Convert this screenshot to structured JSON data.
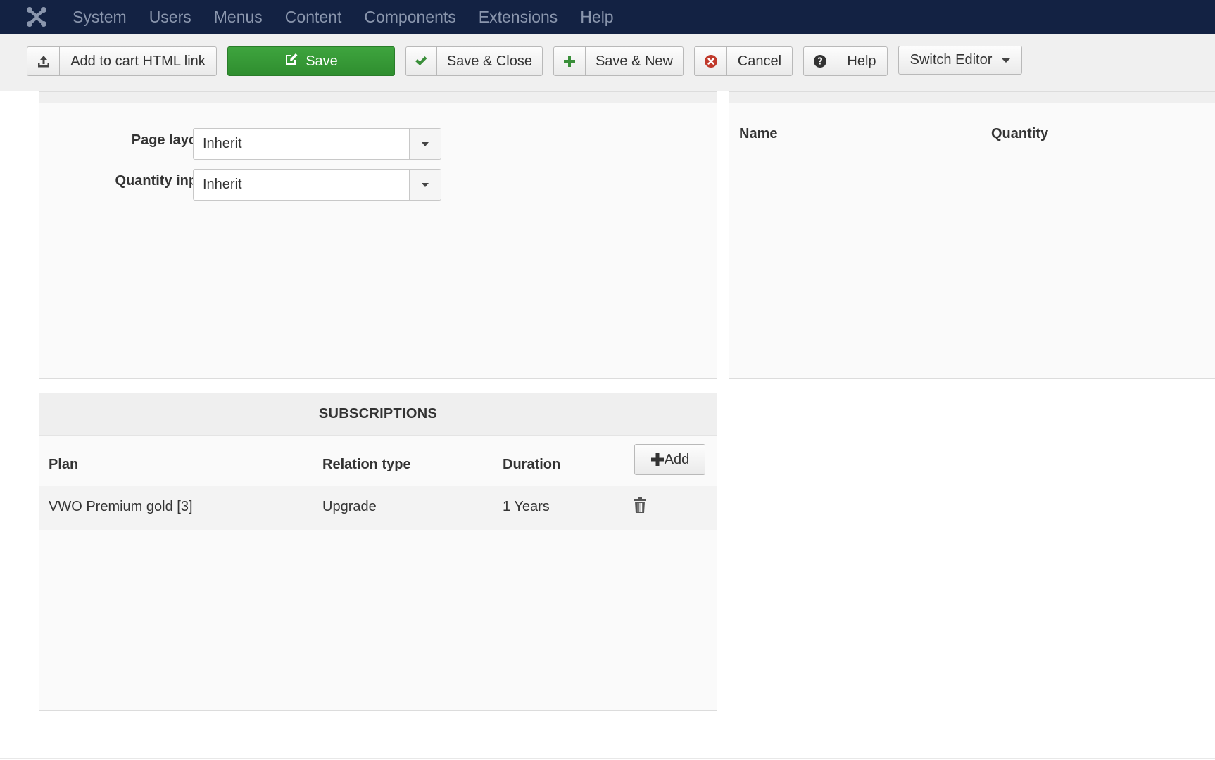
{
  "topnav": {
    "logo_icon": "joomla-logo-icon",
    "items": [
      "System",
      "Users",
      "Menus",
      "Content",
      "Components",
      "Extensions",
      "Help"
    ]
  },
  "toolbar": {
    "add_to_cart_label": "Add to cart HTML link",
    "save_label": "Save",
    "save_close_label": "Save & Close",
    "save_new_label": "Save & New",
    "cancel_label": "Cancel",
    "help_label": "Help",
    "switch_editor_label": "Switch Editor",
    "colors": {
      "save_green": "#35993a",
      "check_green": "#3a8f3a",
      "cancel_red": "#c0392b"
    }
  },
  "settings_panel": {
    "page_layout_label": "Page layout",
    "page_layout_value": "Inherit",
    "quantity_input_label": "Quantity input",
    "quantity_input_value": "Inherit"
  },
  "right_panel": {
    "columns": [
      "Name",
      "Quantity"
    ]
  },
  "subscriptions": {
    "title": "SUBSCRIPTIONS",
    "columns": [
      "Plan",
      "Relation type",
      "Duration"
    ],
    "add_label": "Add",
    "rows": [
      {
        "plan": "VWO Premium gold [3]",
        "relation": "Upgrade",
        "duration": "1 Years"
      }
    ]
  }
}
